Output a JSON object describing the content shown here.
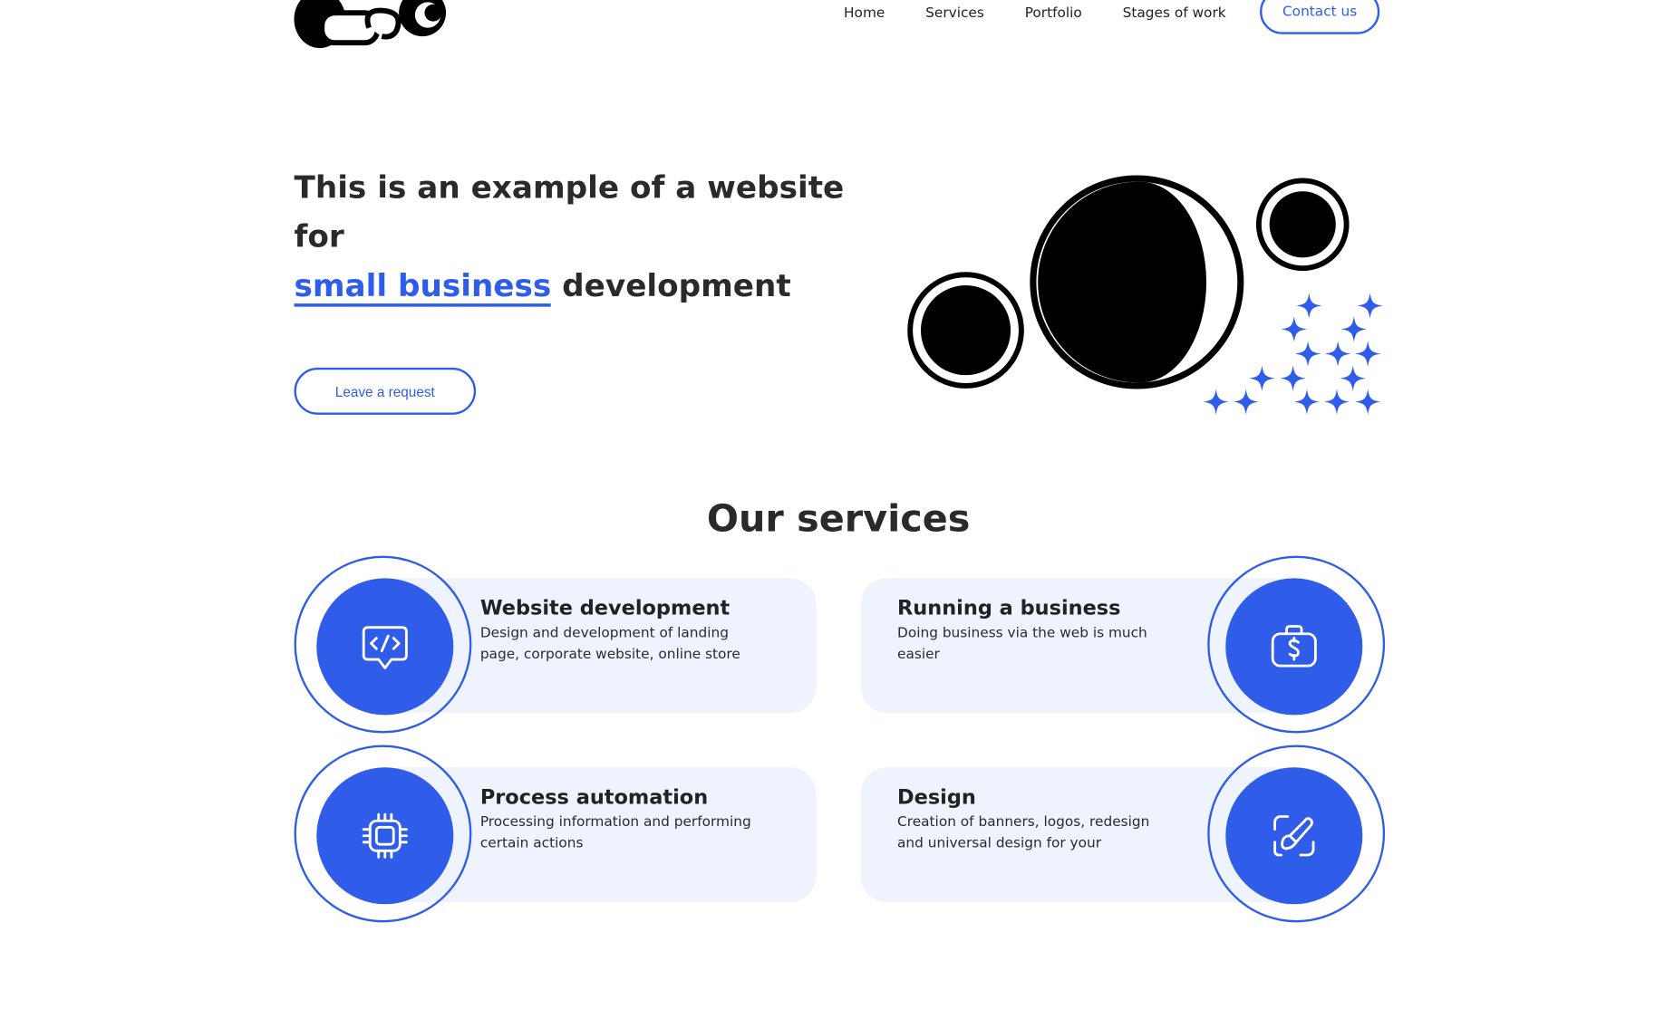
{
  "header": {
    "logo_icon": "logo-mark",
    "nav": [
      "Home",
      "Services",
      "Portfolio",
      "Stages of work"
    ],
    "contact_label": "Contact us"
  },
  "hero": {
    "title_start": "This is an example of a website for",
    "title_highlight": "small business",
    "title_end": "development",
    "request_label": "Leave a request",
    "illustration": "moon-planets-stars"
  },
  "services": {
    "title": "Our services",
    "items": [
      {
        "title": "Website development",
        "text": "Design and development of landing page, corporate website, online store",
        "icon": "code-chat-icon"
      },
      {
        "title": "Running a business",
        "text": "Doing business via the web is much easier",
        "icon": "money-briefcase-icon"
      },
      {
        "title": "Process automation",
        "text": "Processing information and performing certain actions",
        "icon": "chip-icon"
      },
      {
        "title": "Design",
        "text": "Creation of banners, logos, redesign and universal design for your",
        "icon": "brush-icon"
      }
    ]
  },
  "colors": {
    "accent": "#2f5ce8",
    "card_bg": "#eef3fd",
    "text": "#222222"
  }
}
